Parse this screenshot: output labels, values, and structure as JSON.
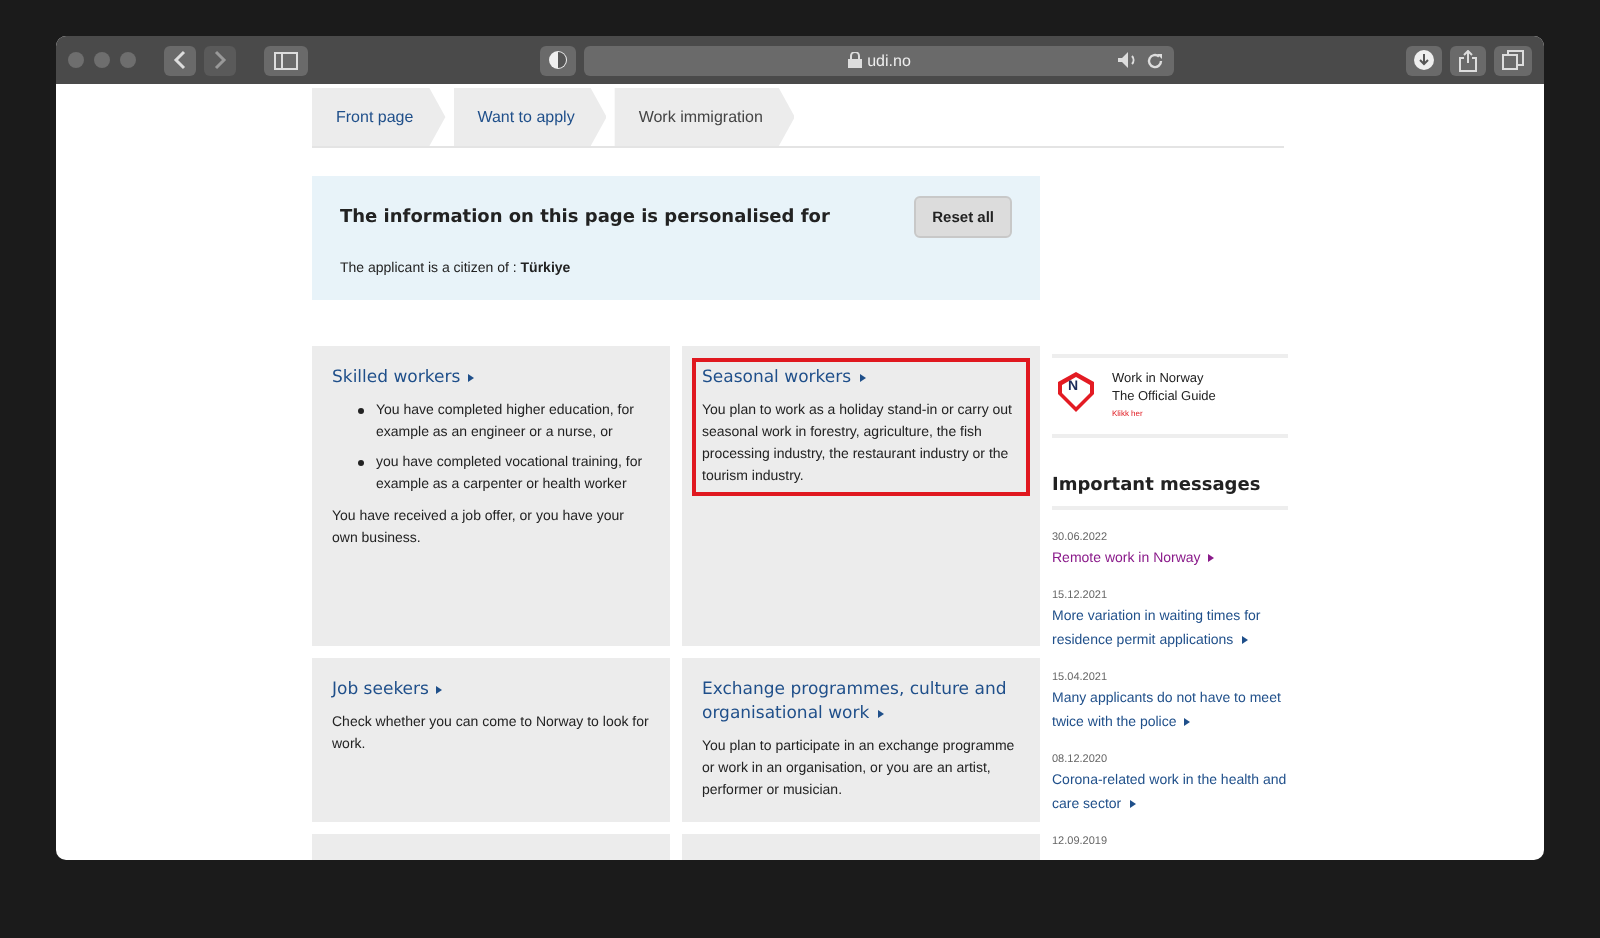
{
  "browser": {
    "address": "udi.no"
  },
  "breadcrumbs": [
    {
      "label": "Front page",
      "current": false
    },
    {
      "label": "Want to apply",
      "current": false
    },
    {
      "label": "Work immigration",
      "current": true
    }
  ],
  "personalisation": {
    "title": "The information on this page is personalised for",
    "citizen_label": "The applicant is a citizen of :",
    "citizen_value": "Türkiye",
    "button": "Reset all"
  },
  "cards": [
    {
      "title": "Skilled workers",
      "highlighted": false,
      "bullets": [
        "You have completed higher education, for example as an engineer or a nurse, or",
        "you have completed vocational training, for example as a carpenter or health worker"
      ],
      "text": "You have received a job offer, or you have your own business."
    },
    {
      "title": "Seasonal workers",
      "highlighted": true,
      "text": "You plan to work as a holiday stand-in or carry out seasonal work in forestry, agriculture, the fish processing industry, the restaurant industry or the tourism industry."
    },
    {
      "title": "Job seekers",
      "highlighted": false,
      "text": "Check whether you can come to Norway to look for work."
    },
    {
      "title": "Exchange programmes, culture and organisational work",
      "highlighted": false,
      "text": "You plan to participate in an exchange programme or work in an organisation, or you are an artist, performer or musician."
    }
  ],
  "promo": {
    "logo_letter": "N",
    "line1": "Work in Norway",
    "line2": "The Official Guide",
    "link": "Klikk her"
  },
  "messages_title": "Important messages",
  "messages": [
    {
      "date": "30.06.2022",
      "title": "Remote work in Norway",
      "visited": true
    },
    {
      "date": "15.12.2021",
      "title": "More variation in waiting times for residence permit applications",
      "visited": false
    },
    {
      "date": "15.04.2021",
      "title": "Many applicants do not have to meet twice with the police",
      "visited": false
    },
    {
      "date": "08.12.2020",
      "title": "Corona-related work in the health and care sector",
      "visited": false
    },
    {
      "date": "12.09.2019"
    }
  ]
}
